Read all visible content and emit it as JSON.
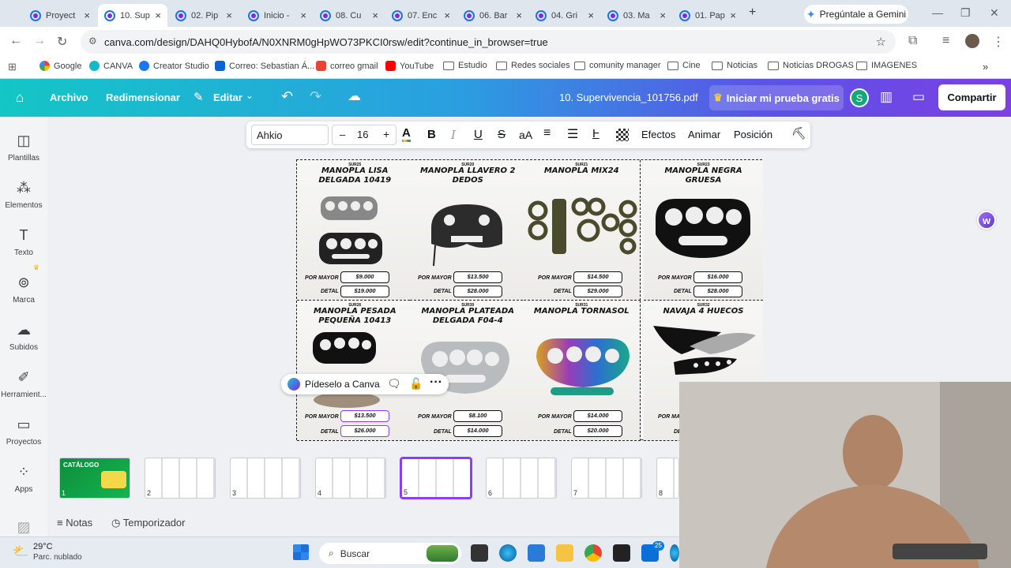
{
  "tabs": [
    {
      "title": "Proyect"
    },
    {
      "title": "10. Sup"
    },
    {
      "title": "02. Pip"
    },
    {
      "title": "Inicio -"
    },
    {
      "title": "08. Cu"
    },
    {
      "title": "07. Enc"
    },
    {
      "title": "06. Bar"
    },
    {
      "title": "04. Gri"
    },
    {
      "title": "03. Ma"
    },
    {
      "title": "01. Pap"
    }
  ],
  "new_tab": "+",
  "gemini": "Pregúntale a Gemini",
  "url": "canva.com/design/DAHQ0HybofA/N0XNRM0gHpWO73PKCI0rsw/edit?continue_in_browser=true",
  "bookmarks": [
    "Google",
    "CANVA",
    "Creator Studio",
    "Correo: Sebastian Á...",
    "correo gmail",
    "YouTube",
    "Estudio",
    "Redes sociales",
    "comunity manager",
    "Cine",
    "Noticias",
    "Noticias DROGAS",
    "IMAGENES"
  ],
  "bookmarks_more": "»",
  "header": {
    "archivo": "Archivo",
    "redimensionar": "Redimensionar",
    "editar": "Editar",
    "doc_title": "10. Supervivencia_101756.pdf",
    "trial": "Iniciar mi prueba gratis",
    "avatar": "S",
    "share": "Compartir"
  },
  "sidebar": [
    {
      "label": "Plantillas",
      "icon": "templates-icon"
    },
    {
      "label": "Elementos",
      "icon": "elements-icon"
    },
    {
      "label": "Texto",
      "icon": "text-icon"
    },
    {
      "label": "Marca",
      "icon": "brand-icon"
    },
    {
      "label": "Subidos",
      "icon": "uploads-icon"
    },
    {
      "label": "Herramient...",
      "icon": "tools-icon"
    },
    {
      "label": "Proyectos",
      "icon": "projects-icon"
    },
    {
      "label": "Apps",
      "icon": "apps-icon"
    }
  ],
  "toolbar": {
    "font": "Ahkio",
    "size": "16",
    "minus": "–",
    "plus": "+",
    "text_color": "A",
    "bold": "B",
    "italic": "I",
    "underline": "U",
    "strike": "S",
    "case": "aA",
    "efectos": "Efectos",
    "animar": "Animar",
    "posicion": "Posición"
  },
  "catalog": {
    "label_mayor": "POR MAYOR",
    "label_detal": "DETAL",
    "products": [
      {
        "code": "SUR25",
        "name": "MANOPLA LISA DELGADA 10419",
        "mayor": "$9.000",
        "detal": "$19.000"
      },
      {
        "code": "SUR20",
        "name": "MANOPLA LLAVERO 2 DEDOS",
        "mayor": "$13.500",
        "detal": "$28.000"
      },
      {
        "code": "SUR21",
        "name": "MANOPLA MIX24",
        "mayor": "$14.500",
        "detal": "$29.000"
      },
      {
        "code": "SUR23",
        "name": "MANOPLA NEGRA GRUESA",
        "mayor": "$16.000",
        "detal": "$28.000"
      },
      {
        "code": "SUR26",
        "name": "MANOPLA PESADA PEQUEÑA 10413",
        "mayor": "$13.500",
        "detal": "$26.000"
      },
      {
        "code": "SUR30",
        "name": "MANOPLA PLATEADA DELGADA F04-4",
        "mayor": "$8.100",
        "detal": "$14.000"
      },
      {
        "code": "SUR31",
        "name": "MANOPLA TORNASOL",
        "mayor": "$14.000",
        "detal": "$20.000"
      },
      {
        "code": "SUR32",
        "name": "NAVAJA 4 HUECOS",
        "mayor": "",
        "detal": ""
      }
    ]
  },
  "pideselo": "Pídeselo a Canva",
  "thumbnails": [
    {
      "num": "1",
      "caption": "CATÁLOGO"
    },
    {
      "num": "2"
    },
    {
      "num": "3"
    },
    {
      "num": "4"
    },
    {
      "num": "5"
    },
    {
      "num": "6"
    },
    {
      "num": "7"
    },
    {
      "num": "8"
    }
  ],
  "bottom": {
    "notas": "Notas",
    "temporizador": "Temporizador"
  },
  "taskbar": {
    "temp": "29°C",
    "weather": "Parc. nublado",
    "search": "Buscar",
    "badge": "25"
  },
  "colors": {
    "canva_gradient_start": "#14c6c6",
    "canva_gradient_end": "#7b3fe4",
    "selection": "#8b3dff"
  }
}
